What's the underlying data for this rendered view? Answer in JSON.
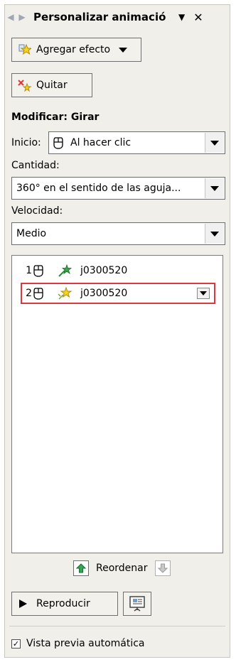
{
  "pane": {
    "title": "Personalizar animació",
    "add_effect_label": "Agregar efecto",
    "remove_label": "Quitar",
    "modify_title": "Modificar: Girar",
    "start": {
      "label": "Inicio:",
      "value": "Al hacer clic"
    },
    "amount": {
      "label": "Cantidad:",
      "value": "360° en el sentido de las aguja..."
    },
    "speed": {
      "label": "Velocidad:",
      "value": "Medio"
    },
    "effects": [
      {
        "num": "1",
        "name": "j0300520",
        "icon": "green-effect-star-icon"
      },
      {
        "num": "2",
        "name": "j0300520",
        "icon": "yellow-effect-star-icon",
        "selected": true
      }
    ],
    "reorder_label": "Reordenar",
    "play_label": "Reproducir",
    "autopreview_label": "Vista previa automática",
    "autopreview_checked": true
  }
}
